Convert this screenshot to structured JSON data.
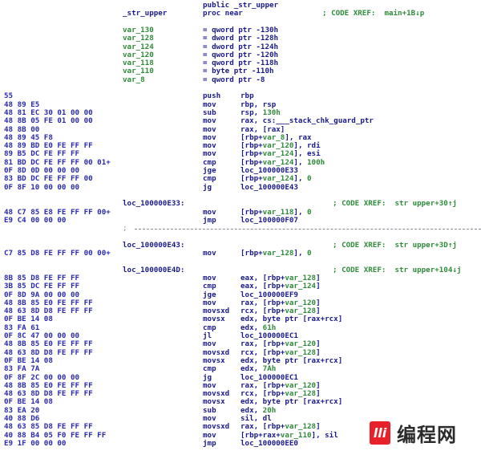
{
  "header": {
    "public_decl": "public _str_upper",
    "proc_label": "_str_upper",
    "proc_decl": "proc near",
    "proc_comment": "; CODE XREF:  main+1B↓p"
  },
  "vars": [
    {
      "name": "var_130",
      "def": "= qword ptr -130h"
    },
    {
      "name": "var_128",
      "def": "= dword ptr -128h"
    },
    {
      "name": "var_124",
      "def": "= dword ptr -124h"
    },
    {
      "name": "var_120",
      "def": "= qword ptr -120h"
    },
    {
      "name": "var_118",
      "def": "= qword ptr -118h"
    },
    {
      "name": "var_110",
      "def": "= byte ptr -110h"
    },
    {
      "name": "var_8",
      "def": "= qword ptr -8"
    }
  ],
  "code": [
    {
      "bytes": "55",
      "mnem": "push",
      "ops": [
        [
          "rbp",
          0
        ]
      ]
    },
    {
      "bytes": "48 89 E5",
      "mnem": "mov",
      "ops": [
        [
          "rbp, rsp",
          0
        ]
      ]
    },
    {
      "bytes": "48 81 EC 30 01 00 00",
      "mnem": "sub",
      "ops": [
        [
          "rsp, ",
          0
        ],
        [
          "130h",
          1
        ]
      ]
    },
    {
      "bytes": "48 8B 05 FE 01 00 00",
      "mnem": "mov",
      "ops": [
        [
          "rax, cs:___stack_chk_guard_ptr",
          0
        ]
      ]
    },
    {
      "bytes": "48 8B 00",
      "mnem": "mov",
      "ops": [
        [
          "rax, [rax]",
          0
        ]
      ]
    },
    {
      "bytes": "48 89 45 F8",
      "mnem": "mov",
      "ops": [
        [
          "[rbp+",
          0
        ],
        [
          "var_8",
          1
        ],
        [
          "], rax",
          0
        ]
      ]
    },
    {
      "bytes": "48 89 BD E0 FE FF FF",
      "mnem": "mov",
      "ops": [
        [
          "[rbp+",
          0
        ],
        [
          "var_120",
          1
        ],
        [
          "], rdi",
          0
        ]
      ]
    },
    {
      "bytes": "89 B5 DC FE FF FF",
      "mnem": "mov",
      "ops": [
        [
          "[rbp+",
          0
        ],
        [
          "var_124",
          1
        ],
        [
          "], esi",
          0
        ]
      ]
    },
    {
      "bytes": "81 BD DC FE FF FF 00 01+",
      "mnem": "cmp",
      "ops": [
        [
          "[rbp+",
          0
        ],
        [
          "var_124",
          1
        ],
        [
          "], ",
          0
        ],
        [
          "100h",
          1
        ]
      ]
    },
    {
      "bytes": "0F 8D 0D 00 00 00",
      "mnem": "jge",
      "ops": [
        [
          "loc_100000E33",
          0
        ]
      ]
    },
    {
      "bytes": "83 BD DC FE FF FF 00",
      "mnem": "cmp",
      "ops": [
        [
          "[rbp+",
          0
        ],
        [
          "var_124",
          1
        ],
        [
          "], ",
          0
        ],
        [
          "0",
          1
        ]
      ]
    },
    {
      "bytes": "0F 8F 10 00 00 00",
      "mnem": "jg",
      "ops": [
        [
          "loc_100000E43",
          0
        ]
      ]
    },
    {
      "blank": true
    },
    {
      "label": "loc_100000E33:",
      "comment": "; CODE XREF:  str upper+30↑j"
    },
    {
      "bytes": "48 C7 85 E8 FE FF FF 00+",
      "mnem": "mov",
      "ops": [
        [
          "[rbp+",
          0
        ],
        [
          "var_118",
          1
        ],
        [
          "], ",
          0
        ],
        [
          "0",
          1
        ]
      ]
    },
    {
      "bytes": "E9 C4 00 00 00",
      "mnem": "jmp",
      "ops": [
        [
          "loc_100000F07",
          0
        ]
      ]
    },
    {
      "separator": true,
      "text": ";"
    },
    {
      "blank": true
    },
    {
      "label": "loc_100000E43:",
      "comment": "; CODE XREF:  str upper+3D↑j"
    },
    {
      "bytes": "C7 85 D8 FE FF FF 00 00+",
      "mnem": "mov",
      "ops": [
        [
          "[rbp+",
          0
        ],
        [
          "var_128",
          1
        ],
        [
          "], ",
          0
        ],
        [
          "0",
          1
        ]
      ]
    },
    {
      "blank": true
    },
    {
      "label": "loc_100000E4D:",
      "comment": "; CODE XREF:  str upper+104↓j"
    },
    {
      "bytes": "8B 85 D8 FE FF FF",
      "mnem": "mov",
      "ops": [
        [
          "eax, [rbp+",
          0
        ],
        [
          "var_128",
          1
        ],
        [
          "]",
          0
        ]
      ]
    },
    {
      "bytes": "3B 85 DC FE FF FF",
      "mnem": "cmp",
      "ops": [
        [
          "eax, [rbp+",
          0
        ],
        [
          "var_124",
          1
        ],
        [
          "]",
          0
        ]
      ]
    },
    {
      "bytes": "0F 8D 9A 00 00 00",
      "mnem": "jge",
      "ops": [
        [
          "loc_100000EF9",
          0
        ]
      ]
    },
    {
      "bytes": "48 8B 85 E0 FE FF FF",
      "mnem": "mov",
      "ops": [
        [
          "rax, [rbp+",
          0
        ],
        [
          "var_120",
          1
        ],
        [
          "]",
          0
        ]
      ]
    },
    {
      "bytes": "48 63 8D D8 FE FF FF",
      "mnem": "movsxd",
      "ops": [
        [
          "rcx, [rbp+",
          0
        ],
        [
          "var_128",
          1
        ],
        [
          "]",
          0
        ]
      ]
    },
    {
      "bytes": "0F BE 14 08",
      "mnem": "movsx",
      "ops": [
        [
          "edx, byte ptr [rax+rcx]",
          0
        ]
      ]
    },
    {
      "bytes": "83 FA 61",
      "mnem": "cmp",
      "ops": [
        [
          "edx, ",
          0
        ],
        [
          "61h",
          1
        ]
      ]
    },
    {
      "bytes": "0F 8C 47 00 00 00",
      "mnem": "jl",
      "ops": [
        [
          "loc_100000EC1",
          0
        ]
      ]
    },
    {
      "bytes": "48 8B 85 E0 FE FF FF",
      "mnem": "mov",
      "ops": [
        [
          "rax, [rbp+",
          0
        ],
        [
          "var_120",
          1
        ],
        [
          "]",
          0
        ]
      ]
    },
    {
      "bytes": "48 63 8D D8 FE FF FF",
      "mnem": "movsxd",
      "ops": [
        [
          "rcx, [rbp+",
          0
        ],
        [
          "var_128",
          1
        ],
        [
          "]",
          0
        ]
      ]
    },
    {
      "bytes": "0F BE 14 08",
      "mnem": "movsx",
      "ops": [
        [
          "edx, byte ptr [rax+rcx]",
          0
        ]
      ]
    },
    {
      "bytes": "83 FA 7A",
      "mnem": "cmp",
      "ops": [
        [
          "edx, ",
          0
        ],
        [
          "7Ah",
          1
        ]
      ]
    },
    {
      "bytes": "0F 8F 2C 00 00 00",
      "mnem": "jg",
      "ops": [
        [
          "loc_100000EC1",
          0
        ]
      ]
    },
    {
      "bytes": "48 8B 85 E0 FE FF FF",
      "mnem": "mov",
      "ops": [
        [
          "rax, [rbp+",
          0
        ],
        [
          "var_120",
          1
        ],
        [
          "]",
          0
        ]
      ]
    },
    {
      "bytes": "48 63 8D D8 FE FF FF",
      "mnem": "movsxd",
      "ops": [
        [
          "rcx, [rbp+",
          0
        ],
        [
          "var_128",
          1
        ],
        [
          "]",
          0
        ]
      ]
    },
    {
      "bytes": "0F BE 14 08",
      "mnem": "movsx",
      "ops": [
        [
          "edx, byte ptr [rax+rcx]",
          0
        ]
      ]
    },
    {
      "bytes": "83 EA 20",
      "mnem": "sub",
      "ops": [
        [
          "edx, ",
          0
        ],
        [
          "20h",
          1
        ]
      ]
    },
    {
      "bytes": "40 88 D6",
      "mnem": "mov",
      "ops": [
        [
          "sil, dl",
          0
        ]
      ]
    },
    {
      "bytes": "48 63 85 D8 FE FF FF",
      "mnem": "movsxd",
      "ops": [
        [
          "rax, [rbp+",
          0
        ],
        [
          "var_128",
          1
        ],
        [
          "]",
          0
        ]
      ]
    },
    {
      "bytes": "40 88 B4 05 F0 FE FF FF",
      "mnem": "mov",
      "ops": [
        [
          "[rbp+rax+",
          0
        ],
        [
          "var_110",
          1
        ],
        [
          "], sil",
          0
        ]
      ]
    },
    {
      "bytes": "E9 1F 00 00 00",
      "mnem": "jmp",
      "ops": [
        [
          "loc_100000EE0",
          0
        ]
      ]
    }
  ],
  "watermark": {
    "logo_text": "lli",
    "site_name": "编程网"
  },
  "colors": {
    "code_blue": "#1a1a8c",
    "bytes_blue": "#2a2ab0",
    "comment_green": "#2e8b3a",
    "separator_gray": "#8a8a9a",
    "watermark_red": "#e8202a"
  }
}
